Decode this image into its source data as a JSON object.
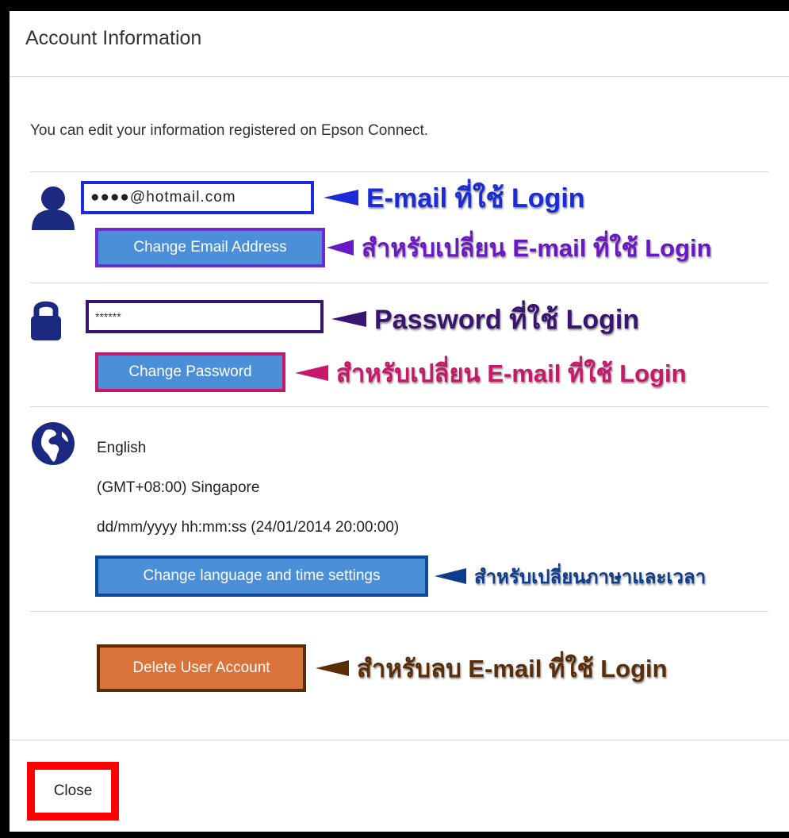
{
  "dialog": {
    "title": "Account Information",
    "intro": "You can edit your information registered on Epson Connect.",
    "close_label": "Close"
  },
  "email": {
    "value": "●●●●@hotmail.com",
    "change_label": "Change Email Address",
    "annotation": "E-mail ที่ใช้ Login",
    "change_annotation": "สำหรับเปลี่ยน E-mail ที่ใช้ Login"
  },
  "password": {
    "value": "******",
    "change_label": "Change Password",
    "annotation": "Password ที่ใช้ Login",
    "change_annotation": "สำหรับเปลี่ยน E-mail ที่ใช้ Login"
  },
  "settings": {
    "language": "English",
    "timezone": "(GMT+08:00) Singapore",
    "datetime": "dd/mm/yyyy hh:mm:ss (24/01/2014 20:00:00)",
    "change_label": "Change language and time settings",
    "change_annotation": "สำหรับเปลี่ยนภาษาและเวลา"
  },
  "account": {
    "delete_label": "Delete User Account",
    "delete_annotation": "สำหรับลบ E-mail ที่ใช้ Login"
  },
  "colors": {
    "icon_navy": "#1b2a80",
    "button_blue": "#4a8fd8",
    "delete_orange": "#d9733a",
    "close_highlight": "#ff0000"
  },
  "icons": [
    "user-icon",
    "lock-icon",
    "globe-icon"
  ]
}
